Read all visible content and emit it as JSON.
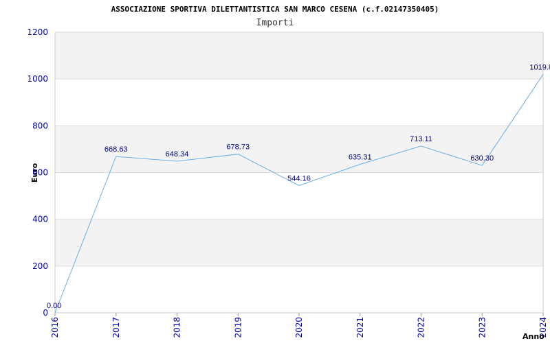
{
  "chart_data": {
    "type": "line",
    "title": "ASSOCIAZIONE SPORTIVA DILETTANTISTICA SAN MARCO CESENA (c.f.02147350405)",
    "subtitle": "Importi",
    "xlabel": "Anno",
    "ylabel": "Euro",
    "ylim": [
      0,
      1200
    ],
    "yticks": [
      0,
      200,
      400,
      600,
      800,
      1000,
      1200
    ],
    "categories": [
      "2016",
      "2017",
      "2018",
      "2019",
      "2020",
      "2021",
      "2022",
      "2023",
      "2024"
    ],
    "values": [
      0.0,
      668.63,
      648.34,
      678.73,
      544.16,
      635.31,
      713.11,
      630.3,
      1019.8
    ],
    "labels": [
      "0.00",
      "668.63",
      "648.34",
      "678.73",
      "544.16",
      "635.31",
      "713.11",
      "630.30",
      "1019.8"
    ],
    "grid": true,
    "colors": {
      "line": "#6aaee8",
      "band": "#f3f3f3",
      "tick_text": "#0000aa",
      "label_text": "#000080"
    }
  }
}
